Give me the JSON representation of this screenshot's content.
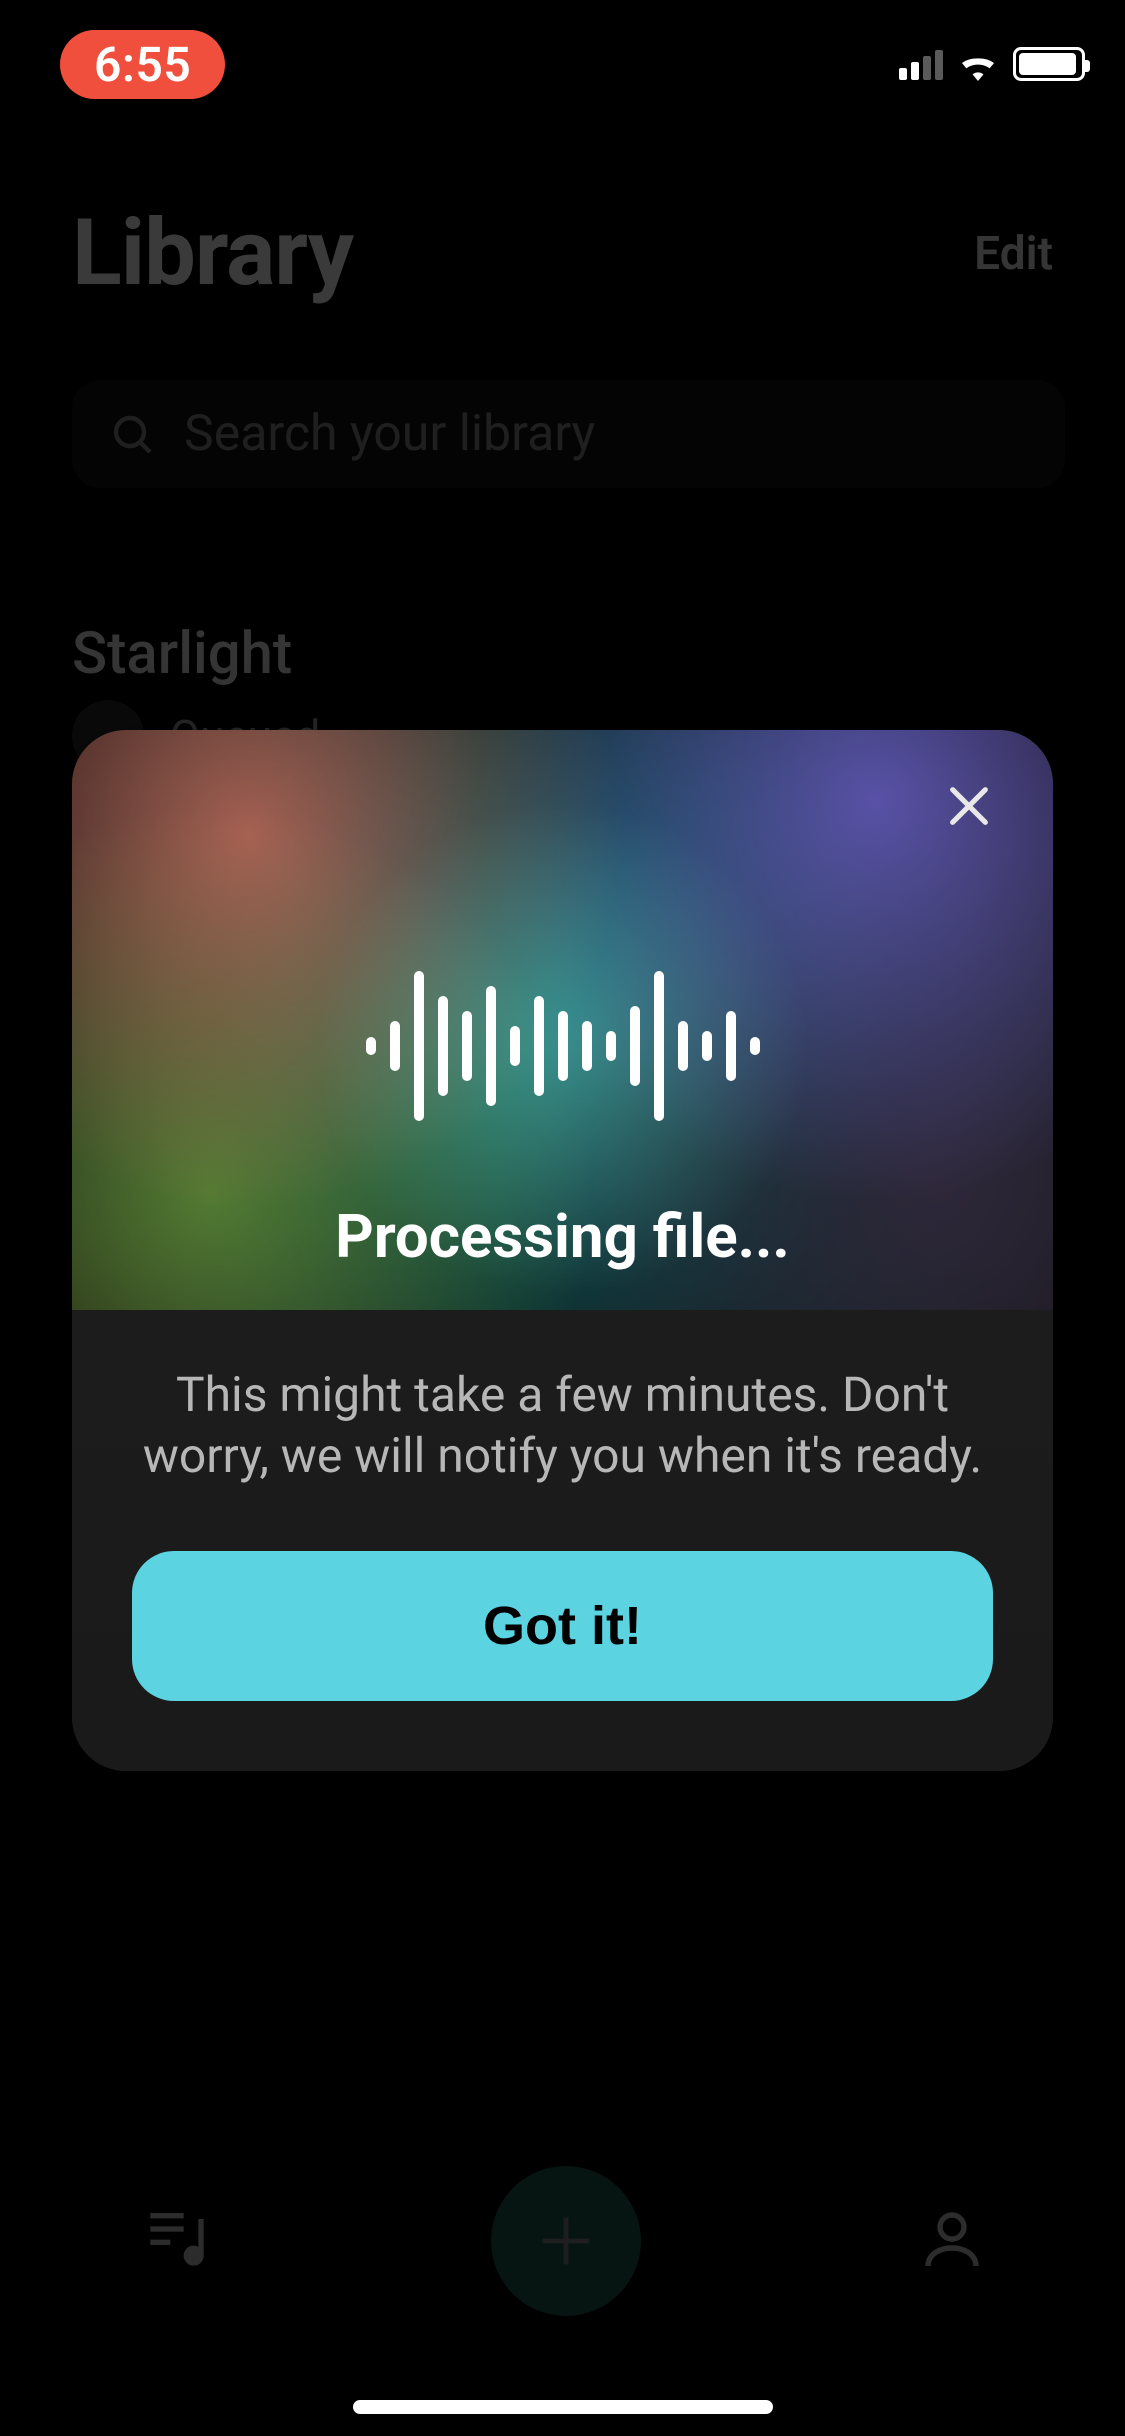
{
  "status": {
    "time": "6:55",
    "pill_color": "#ef4f3c"
  },
  "header": {
    "title": "Library",
    "edit_label": "Edit"
  },
  "search": {
    "placeholder": "Search your library"
  },
  "track": {
    "title": "Starlight",
    "status": "Queued"
  },
  "modal": {
    "title": "Processing file...",
    "description": "This might take a few minutes. Don't worry, we will notify you when it's ready.",
    "cta_label": "Got it!"
  },
  "colors": {
    "accent": "#5bd3e0"
  }
}
